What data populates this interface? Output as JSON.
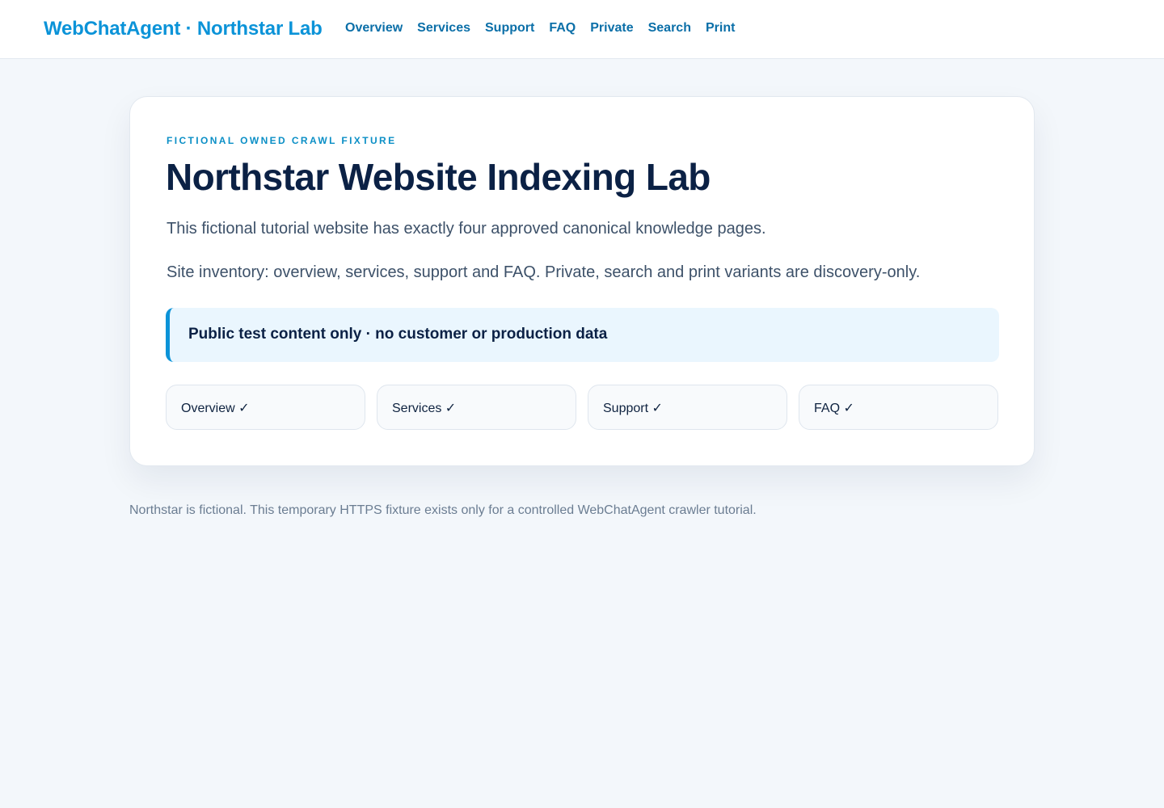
{
  "header": {
    "brand": "WebChatAgent · Northstar Lab",
    "nav": [
      "Overview",
      "Services",
      "Support",
      "FAQ",
      "Private",
      "Search",
      "Print"
    ]
  },
  "hero": {
    "eyebrow": "FICTIONAL OWNED CRAWL FIXTURE",
    "title": "Northstar Website Indexing Lab",
    "intro": "This fictional tutorial website has exactly four approved canonical knowledge pages.",
    "inventory": "Site inventory: overview, services, support and FAQ. Private, search and print variants are discovery-only.",
    "notice": "Public test content only · no customer or production data",
    "pages": [
      "Overview ✓",
      "Services ✓",
      "Support ✓",
      "FAQ ✓"
    ]
  },
  "footer": {
    "text": "Northstar is fictional. This temporary HTTPS fixture exists only for a controlled WebChatAgent crawler tutorial."
  },
  "colors": {
    "accent": "#0b93d8",
    "nav_link": "#0b6fa8",
    "heading": "#0b2145",
    "page_background": "#f3f7fb",
    "notice_background": "#eaf6fe"
  }
}
